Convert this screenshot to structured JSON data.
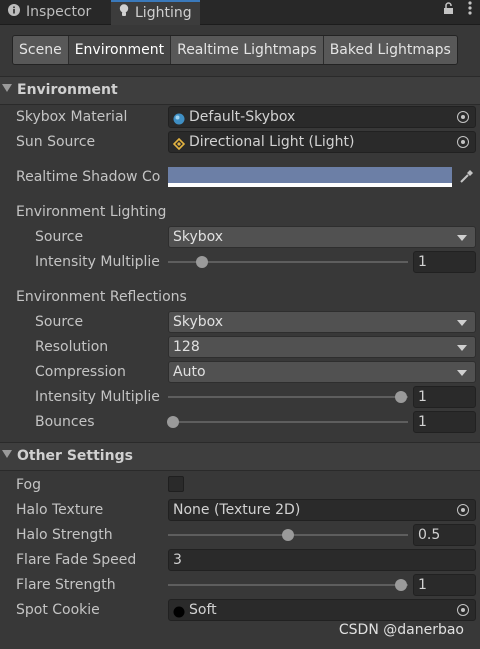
{
  "window_tabs": [
    {
      "label": "Inspector",
      "icon": "info-icon"
    },
    {
      "label": "Lighting",
      "icon": "lightbulb-icon"
    }
  ],
  "header_icons": [
    "lock-icon",
    "menu-dots-icon"
  ],
  "toolbar": [
    "Scene",
    "Environment",
    "Realtime Lightmaps",
    "Baked Lightmaps"
  ],
  "selected_toolbar": "Environment",
  "environment": {
    "title": "Environment",
    "skybox_material": {
      "label": "Skybox Material",
      "value": "Default-Skybox",
      "icon": "sphere-material-icon"
    },
    "sun_source": {
      "label": "Sun Source",
      "value": "Directional Light (Light)",
      "icon": "directional-light-icon"
    },
    "realtime_shadow_color": {
      "label": "Realtime Shadow Co",
      "color": "#6c7fa6"
    },
    "lighting": {
      "title": "Environment Lighting",
      "source": {
        "label": "Source",
        "value": "Skybox"
      },
      "intensity": {
        "label": "Intensity Multiplie",
        "value": "1",
        "slider_fraction": 0.14
      }
    },
    "reflections": {
      "title": "Environment Reflections",
      "source": {
        "label": "Source",
        "value": "Skybox"
      },
      "resolution": {
        "label": "Resolution",
        "value": "128"
      },
      "compression": {
        "label": "Compression",
        "value": "Auto"
      },
      "intensity": {
        "label": "Intensity Multiplie",
        "value": "1",
        "slider_fraction": 0.97
      },
      "bounces": {
        "label": "Bounces",
        "value": "1",
        "slider_fraction": 0.02
      }
    }
  },
  "other": {
    "title": "Other Settings",
    "fog": {
      "label": "Fog",
      "checked": false
    },
    "halo_texture": {
      "label": "Halo Texture",
      "value": "None (Texture 2D)"
    },
    "halo_strength": {
      "label": "Halo Strength",
      "value": "0.5",
      "slider_fraction": 0.5
    },
    "flare_fade_speed": {
      "label": "Flare Fade Speed",
      "value": "3"
    },
    "flare_strength": {
      "label": "Flare Strength",
      "value": "1",
      "slider_fraction": 0.97
    },
    "spot_cookie": {
      "label": "Spot Cookie",
      "value": "Soft",
      "icon": "soft-cookie-icon"
    }
  },
  "watermark": "CSDN @danerbao",
  "accent_color": "#3a79bb"
}
